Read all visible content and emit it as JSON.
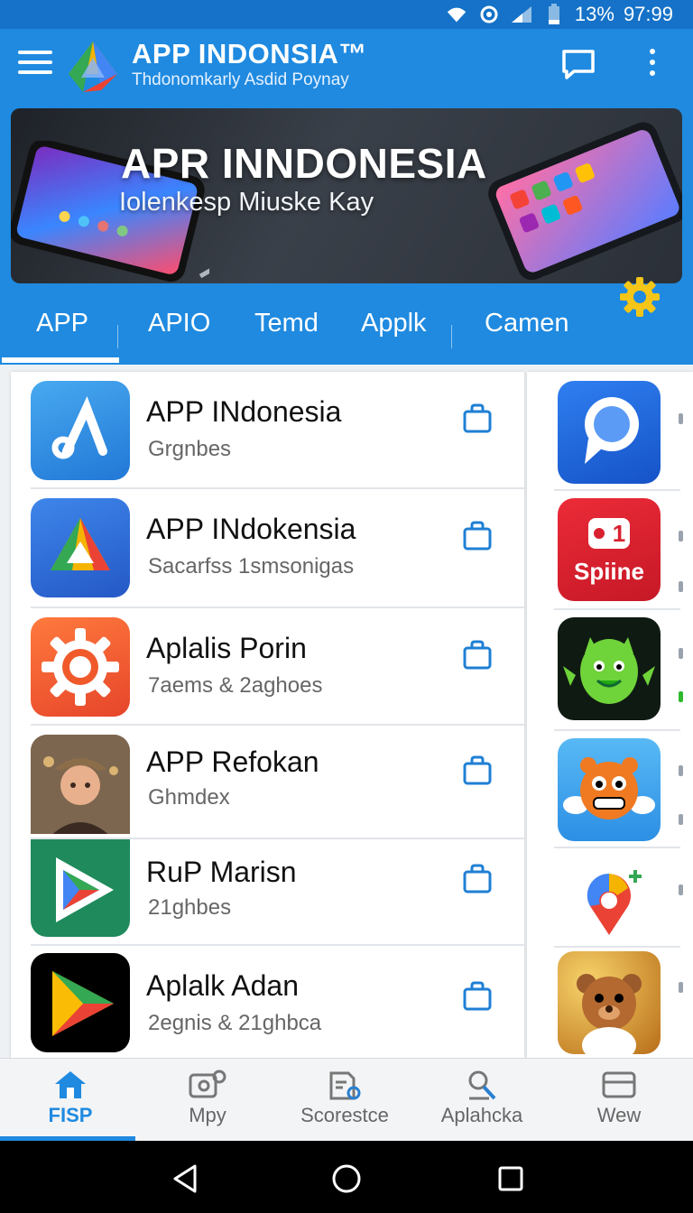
{
  "status_bar": {
    "battery": "13%",
    "time": "97:99"
  },
  "header": {
    "title": "APP INDONSIA™",
    "subtitle": "Thdonomkarly Asdid Poynay"
  },
  "banner": {
    "title": "APR INNDONESIA",
    "subtitle": "Iolenkesp Miuske Kay"
  },
  "tabs": [
    {
      "label": "APP",
      "active": true
    },
    {
      "label": "APIO"
    },
    {
      "label": "Temd"
    },
    {
      "label": "Applk"
    },
    {
      "label": "Camen"
    }
  ],
  "apps": [
    {
      "name": "APP INdonesia",
      "detail": "Grgnbes",
      "icon": "app-indonesia-icon",
      "color": "#2f8fe0"
    },
    {
      "name": "APP INdokensia",
      "detail": "Sacarfss  1smsonigas",
      "icon": "triangle-logo-icon",
      "color": "#2f6fd6"
    },
    {
      "name": "Aplalis Porin",
      "detail": "7aems &  2aghoes",
      "icon": "settings-gear-icon",
      "color": "#f0562a"
    },
    {
      "name": "APP Refokan",
      "detail": "Ghmdex",
      "icon": "portrait-icon",
      "color": "#6b5a4a"
    },
    {
      "name": "RuP Marisn",
      "detail": "21ghbes",
      "icon": "play-store-icon",
      "color": "#1f8a5c"
    },
    {
      "name": "Aplalk Adan",
      "detail": "2egnis & 21ghbca",
      "icon": "play-icon",
      "color": "#000000"
    }
  ],
  "side_apps": [
    {
      "icon": "search-app-icon",
      "color": "#1e6de0"
    },
    {
      "icon": "spiine-app-icon",
      "label": "Spiine",
      "badge": "1",
      "color": "#d8202f"
    },
    {
      "icon": "green-monster-icon",
      "color": "#0f1a12"
    },
    {
      "icon": "orange-critter-icon",
      "color": "#32a6ee"
    },
    {
      "icon": "location-pin-icon",
      "color": "#ffffff"
    },
    {
      "icon": "bear-character-icon",
      "color": "#c78222"
    }
  ],
  "bottom_nav": [
    {
      "label": "FISP",
      "icon": "home-icon",
      "active": true
    },
    {
      "label": "Mpy",
      "icon": "map-icon"
    },
    {
      "label": "Scorestce",
      "icon": "document-icon"
    },
    {
      "label": "Aplahcka",
      "icon": "key-icon"
    },
    {
      "label": "Wew",
      "icon": "card-icon"
    }
  ],
  "colors": {
    "primary": "#1f8ae0",
    "status_bar": "#1572c8",
    "accent_gear": "#f5c518"
  }
}
